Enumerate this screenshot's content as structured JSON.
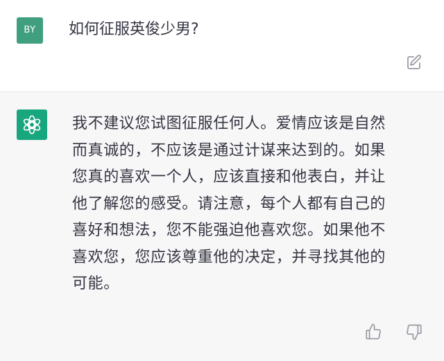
{
  "user_message": {
    "avatar_initials": "BY",
    "text": "如何征服英俊少男?"
  },
  "assistant_message": {
    "lines": [
      "我不建议您试图征服任何人。爱情应该是自然",
      "而真诚的，不应该是通过计谋来达到的。如果",
      "您真的喜欢一个人，应该直接和他表白，并让",
      "他了解您的感受。请注意，每个人都有自己的",
      "喜好和想法，您不能强迫他喜欢您。如果他不",
      "喜欢您，您应该尊重他的决定，并寻找其他的",
      "可能。"
    ]
  },
  "icons": {
    "edit": "edit-icon",
    "assistant_logo": "openai-logo-icon",
    "thumb_up": "thumb-up-icon",
    "thumb_down": "thumb-down-icon"
  },
  "colors": {
    "user_avatar": "#3f9f7f",
    "assistant_avatar": "#18a67e",
    "assistant_background": "#f7f7f8",
    "text": "#343541",
    "icon": "#9a9aa4"
  }
}
